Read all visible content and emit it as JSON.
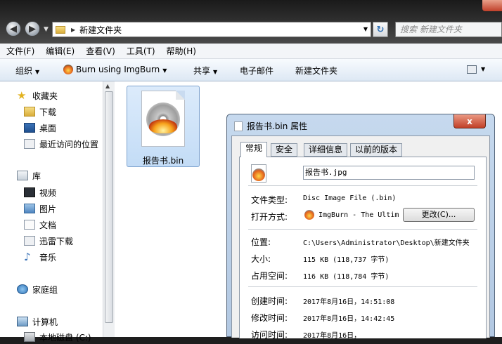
{
  "titlebar": {
    "address_path": "新建文件夹",
    "search_placeholder": "搜索 新建文件夹"
  },
  "menu": [
    "文件(F)",
    "编辑(E)",
    "查看(V)",
    "工具(T)",
    "帮助(H)"
  ],
  "commands": {
    "organize": "组织",
    "burn": "Burn using ImgBurn",
    "share": "共享",
    "email": "电子邮件",
    "new_folder": "新建文件夹"
  },
  "sidebar": {
    "favorites": "收藏夹",
    "downloads": "下载",
    "desktop": "桌面",
    "recent": "最近访问的位置",
    "libraries": "库",
    "videos": "视频",
    "pictures": "图片",
    "documents": "文档",
    "xunlei": "迅雷下载",
    "music": "音乐",
    "homegroup": "家庭组",
    "computer": "计算机",
    "local_disk": "本地磁盘 (C:)"
  },
  "file": {
    "name": "报告书.bin"
  },
  "dialog": {
    "title": "报告书.bin 属性",
    "close": "x",
    "tabs": [
      "常规",
      "安全",
      "详细信息",
      "以前的版本"
    ],
    "name_value": "报告书.jpg",
    "labels": {
      "file_type": "文件类型:",
      "open_with": "打开方式:",
      "location": "位置:",
      "size": "大小:",
      "size_on_disk": "占用空间:",
      "created": "创建时间:",
      "modified": "修改时间:",
      "accessed": "访问时间:"
    },
    "values": {
      "file_type": "Disc Image File (.bin)",
      "open_with": "ImgBurn - The Ultim",
      "location": "C:\\Users\\Administrator\\Desktop\\新建文件夹",
      "size": "115 KB (118,737 字节)",
      "size_on_disk": "116 KB (118,784 字节)",
      "created": "2017年8月16日，14:51:08",
      "modified": "2017年8月16日，14:42:45",
      "accessed": "2017年8月16日，"
    },
    "change_button": "更改(C)..."
  }
}
